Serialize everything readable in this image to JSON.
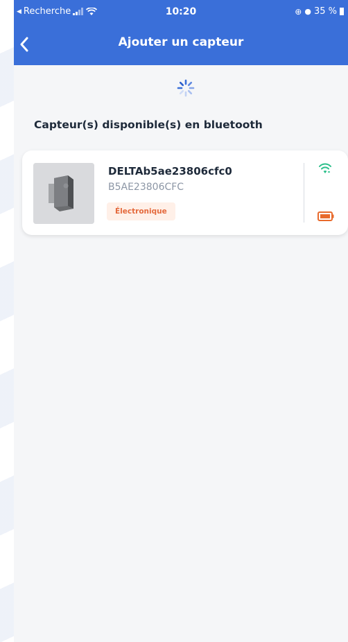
{
  "status_bar": {
    "carrier": "Recherche",
    "time": "10:20",
    "battery_percent": "35 %"
  },
  "navbar": {
    "title": "Ajouter un capteur",
    "back_icon": "chevron-left-icon"
  },
  "loading": {
    "icon": "spinner-icon"
  },
  "section": {
    "title": "Capteur(s) disponible(s) en bluetooth"
  },
  "devices": [
    {
      "name": "DELTAb5ae23806cfc0",
      "id": "B5AE23806CFC",
      "tag": "Électronique",
      "signal_icon": "wifi-icon",
      "battery_icon": "battery-icon"
    }
  ],
  "colors": {
    "primary": "#3a6fd9",
    "tag_text": "#e4693c",
    "tag_bg": "#fff0e8",
    "signal": "#2bbf8a",
    "battery": "#e86a2c"
  }
}
